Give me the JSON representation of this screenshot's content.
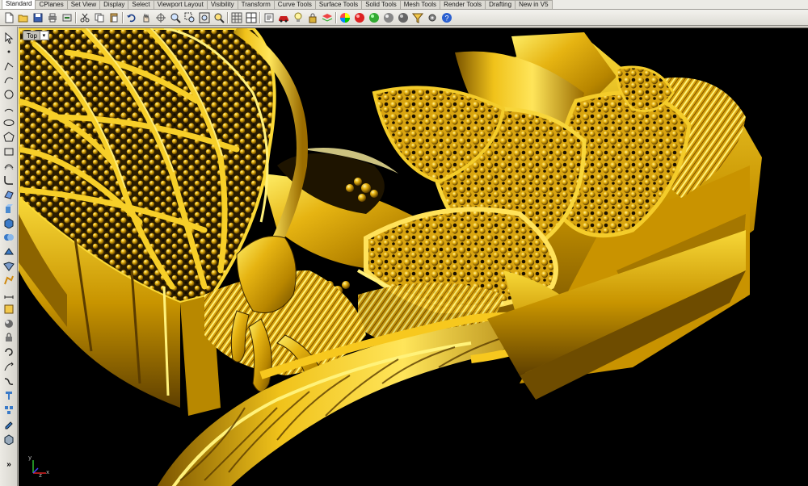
{
  "tabs": [
    {
      "label": "Standard",
      "active": true
    },
    {
      "label": "CPlanes"
    },
    {
      "label": "Set View"
    },
    {
      "label": "Display"
    },
    {
      "label": "Select"
    },
    {
      "label": "Viewport Layout"
    },
    {
      "label": "Visibility"
    },
    {
      "label": "Transform"
    },
    {
      "label": "Curve Tools"
    },
    {
      "label": "Surface Tools"
    },
    {
      "label": "Solid Tools"
    },
    {
      "label": "Mesh Tools"
    },
    {
      "label": "Render Tools"
    },
    {
      "label": "Drafting"
    },
    {
      "label": "New in V5"
    }
  ],
  "toolbar_icons": [
    "new-file-icon",
    "open-folder-icon",
    "save-icon",
    "print-icon",
    "import-icon",
    "cut-icon",
    "copy-icon",
    "paste-icon",
    "undo-icon",
    "pan-hand-icon",
    "rotate-view-icon",
    "zoom-icon",
    "zoom-window-icon",
    "zoom-extents-icon",
    "zoom-selected-icon",
    "grid-icon",
    "four-viewports-icon",
    "object-properties-icon",
    "car-icon",
    "light-bulb-icon",
    "lock-icon",
    "layers-icon",
    "color-wheel-icon",
    "render-sphere-icon",
    "shaded-sphere-icon",
    "grey-sphere-icon",
    "render-settings-icon",
    "filter-icon",
    "options-gear-icon",
    "help-icon"
  ],
  "left_tools": [
    "select-arrow-icon",
    "point-icon",
    "polyline-icon",
    "curve-icon",
    "circle-icon",
    "arc-icon",
    "ellipse-icon",
    "polygon-icon",
    "rectangle-icon",
    "offset-icon",
    "fillet-icon",
    "surface-icon",
    "extrude-icon",
    "box-icon",
    "boolean-icon",
    "solid-edit-icon",
    "mesh-icon",
    "transform-icon",
    "dimension-icon",
    "analyze-icon",
    "render-icon",
    "lock-object-icon",
    "history-icon",
    "array-icon",
    "join-icon",
    "text-icon",
    "group-icon",
    "properties-icon",
    "layer-box-icon",
    "more-tools-icon"
  ],
  "viewport": {
    "name": "Top",
    "dropdown_glyph": "▾",
    "background": "#000000",
    "model_color": "#d4a409",
    "axis_labels": {
      "x": "x",
      "y": "y",
      "z": "z"
    }
  },
  "more_glyph": "»"
}
